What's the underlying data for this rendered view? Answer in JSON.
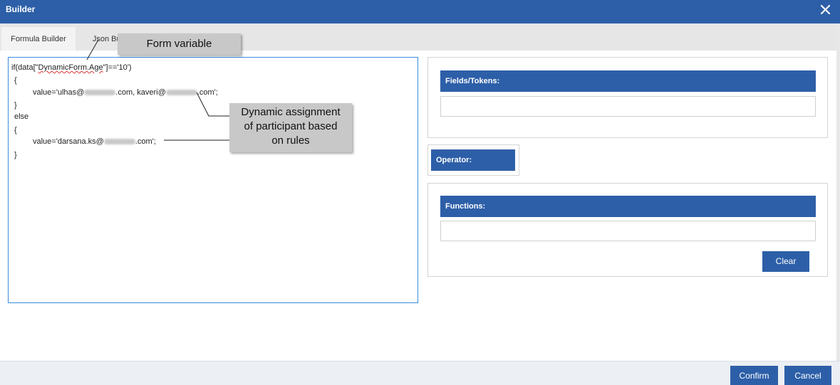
{
  "window": {
    "title": "Builder",
    "close_icon": "close-icon"
  },
  "tabs": [
    {
      "label": "Formula Builder",
      "active": true
    },
    {
      "label": "Json Bui"
    }
  ],
  "editor": {
    "line1_prefix": "if(data[\"",
    "line1_var": "DynamicForm.Age",
    "line1_suffix": "\"]=='10')",
    "line2": "{",
    "line3_a": "value='ulhas@",
    "line3_b": ".com, kaveri@",
    "line3_c": ".com';",
    "line4": "}",
    "line5": "else",
    "line6": "{",
    "line7_a": "value='darsana.ks@",
    "line7_b": ".com';",
    "line8": "}"
  },
  "callouts": {
    "form_variable": "Form variable",
    "dynamic_line1": "Dynamic assignment",
    "dynamic_line2": "of participant based",
    "dynamic_line3": "on rules"
  },
  "panels": {
    "fields_tokens_label": "Fields/Tokens:",
    "operator_label": "Operator:",
    "functions_label": "Functions:",
    "clear_label": "Clear"
  },
  "footer": {
    "confirm_label": "Confirm",
    "cancel_label": "Cancel"
  },
  "colors": {
    "primary": "#2d5fa8",
    "editor_border": "#3a8dde",
    "callout_bg": "#c8c8c8"
  }
}
